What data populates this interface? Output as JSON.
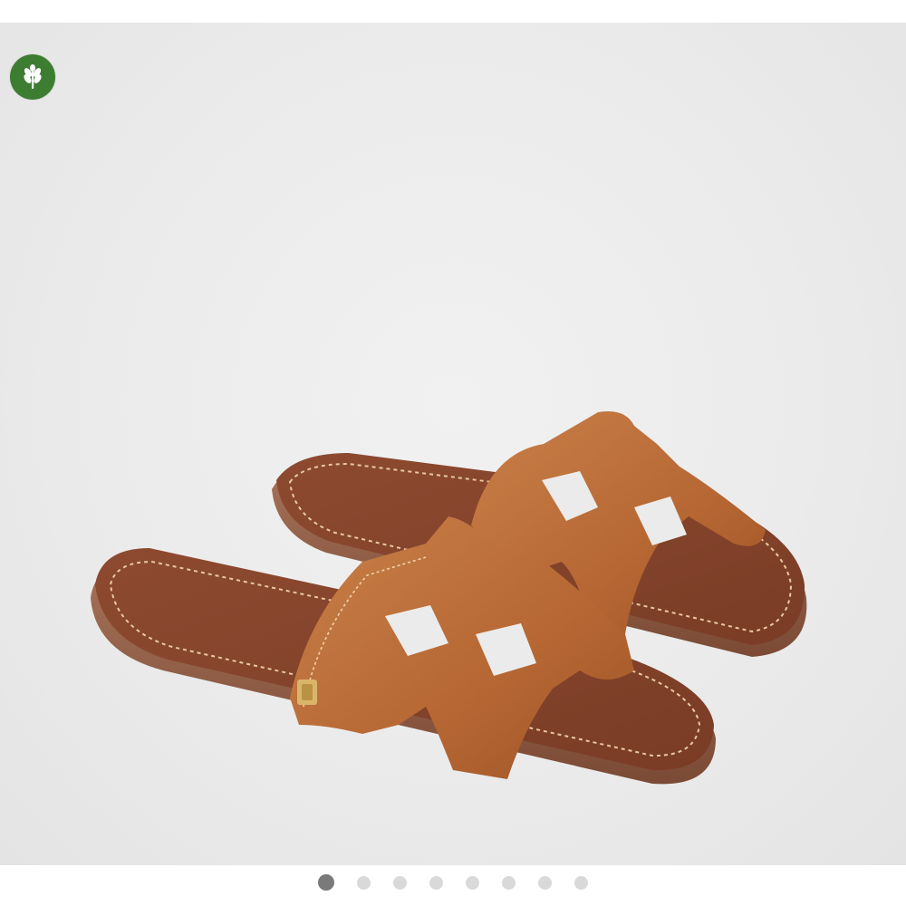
{
  "badge": {
    "icon": "wheat-leaf-icon",
    "color": "#3d7d32"
  },
  "product_image": {
    "subject": "sandal-pair"
  },
  "carousel": {
    "total": 8,
    "active_index": 0
  },
  "colors": {
    "background": "#ebebeb",
    "leather": "#b96a36",
    "sole": "#8a4a2e",
    "dot": "#d9d9d9",
    "dot_active": "#7a7a7a"
  }
}
